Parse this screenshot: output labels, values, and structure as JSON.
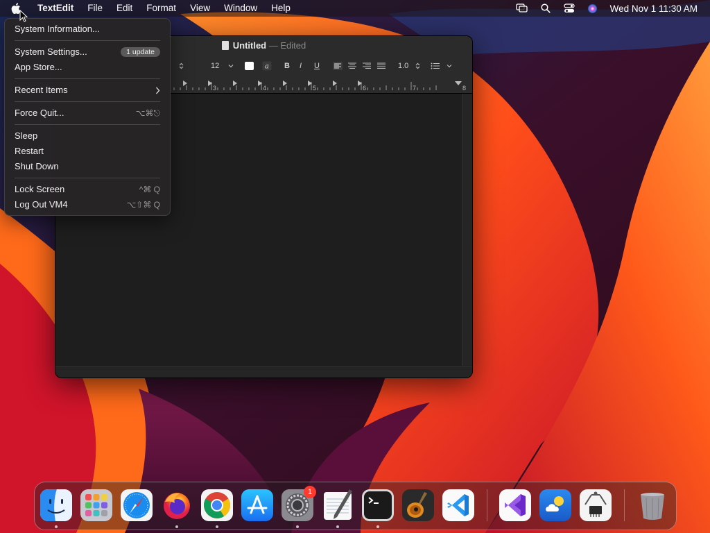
{
  "menubar": {
    "app_name": "TextEdit",
    "menus": [
      "File",
      "Edit",
      "Format",
      "View",
      "Window",
      "Help"
    ],
    "clock": "Wed Nov 1  11:30 AM",
    "status_icons": [
      "screen-mirroring-icon",
      "spotlight-search-icon",
      "control-center-icon",
      "siri-icon"
    ]
  },
  "apple_menu": {
    "items": [
      {
        "label": "System Information..."
      },
      {
        "label": "System Settings...",
        "badge": "1 update"
      },
      {
        "label": "App Store..."
      },
      {
        "label": "Recent Items"
      },
      {
        "label": "Force Quit...",
        "shortcut": "⌥⌘⎋"
      },
      {
        "label": "Sleep"
      },
      {
        "label": "Restart"
      },
      {
        "label": "Shut Down"
      },
      {
        "label": "Lock Screen",
        "shortcut": "^⌘ Q"
      },
      {
        "label": "Log Out VM4",
        "shortcut": "⌥⇧⌘ Q"
      }
    ]
  },
  "window": {
    "title": "Untitled",
    "separator": "—",
    "status": "Edited",
    "toolbar": {
      "font_size": "12",
      "bold": "B",
      "italic": "I",
      "underline": "U",
      "line_spacing": "1.0"
    },
    "ruler_labels": [
      "3",
      "4",
      "5",
      "6",
      "7",
      "8"
    ]
  },
  "dock": {
    "apps": [
      {
        "name": "Finder",
        "icon": "finder-icon",
        "running": true
      },
      {
        "name": "Launchpad",
        "icon": "launchpad-icon",
        "running": false
      },
      {
        "name": "Safari",
        "icon": "safari-icon",
        "running": false
      },
      {
        "name": "Firefox",
        "icon": "firefox-icon",
        "running": true
      },
      {
        "name": "Chrome",
        "icon": "chrome-icon",
        "running": true
      },
      {
        "name": "App Store",
        "icon": "app-store-icon",
        "running": false
      },
      {
        "name": "System Settings",
        "icon": "system-settings-icon",
        "running": true,
        "badge": "1"
      },
      {
        "name": "TextEdit",
        "icon": "textedit-icon",
        "running": true
      },
      {
        "name": "Terminal",
        "icon": "terminal-icon",
        "running": true
      },
      {
        "name": "GarageBand",
        "icon": "garageband-icon",
        "running": false
      },
      {
        "name": "Visual Studio Code",
        "icon": "vscode-icon",
        "running": false
      },
      {
        "name": "Visual Studio",
        "icon": "visual-studio-icon",
        "running": false
      },
      {
        "name": "Weather",
        "icon": "weather-icon",
        "running": false
      },
      {
        "name": "System Information",
        "icon": "system-information-icon",
        "running": false
      },
      {
        "name": "Trash",
        "icon": "trash-icon",
        "running": false
      }
    ]
  },
  "colors": {
    "accent": "#3b82f6",
    "badge_red": "#ff3b30",
    "wallpaper_orange": "#ff5a1e",
    "wallpaper_purple": "#4a0f3a"
  }
}
